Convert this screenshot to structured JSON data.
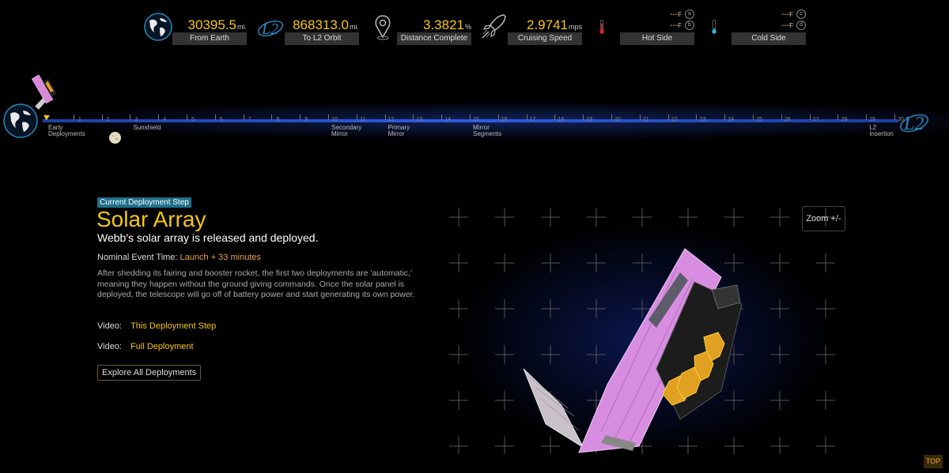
{
  "stats": [
    {
      "value": "30395.5",
      "unit": "mi.",
      "label": "From Earth",
      "icon": "earth-icon"
    },
    {
      "value": "868313.0",
      "unit": "mi.",
      "label": "To L2 Orbit",
      "icon": "l2-orbit-icon"
    },
    {
      "value": "3.3821",
      "unit": "%",
      "label": "Distance Complete",
      "icon": "map-pin-icon"
    },
    {
      "value": "2.9741",
      "unit": "mps",
      "label": "Cruising Speed",
      "icon": "rocket-icon"
    }
  ],
  "temps": [
    {
      "label": "Hot Side",
      "icon": "thermometer-hot-icon",
      "rows": [
        {
          "value": "---",
          "unit": "F",
          "key": "a"
        },
        {
          "value": "---",
          "unit": "F",
          "key": "b"
        }
      ]
    },
    {
      "label": "Cold Side",
      "icon": "thermometer-cold-icon",
      "rows": [
        {
          "value": "---",
          "unit": "F",
          "key": "c"
        },
        {
          "value": "---",
          "unit": "F",
          "key": "d"
        }
      ]
    }
  ],
  "timeline": {
    "days": [
      "0",
      "1",
      "2",
      "3",
      "4",
      "5",
      "6",
      "7",
      "8",
      "9",
      "10",
      "11",
      "12",
      "13",
      "14",
      "15",
      "16",
      "17",
      "18",
      "19",
      "20",
      "21",
      "22",
      "23",
      "24",
      "25",
      "26",
      "27",
      "28",
      "29",
      "30"
    ],
    "milestones": [
      {
        "line1": "Early",
        "line2": "Deployments",
        "day": 0
      },
      {
        "line1": "Sunshield",
        "line2": "",
        "day": 3
      },
      {
        "line1": "Secondary",
        "line2": "Mirror",
        "day": 10
      },
      {
        "line1": "Primary",
        "line2": "Mirror",
        "day": 12
      },
      {
        "line1": "Mirror",
        "line2": "Segments",
        "day": 15
      },
      {
        "line1": "L2",
        "line2": "Insertion",
        "day": 29
      }
    ],
    "end_label": "L2"
  },
  "step": {
    "tag": "Current Deployment Step",
    "title": "Solar Array",
    "subtitle": "Webb's solar array is released and deployed.",
    "event_time_label": "Nominal Event Time:",
    "event_time_value": "Launch + 33 minutes",
    "description": "After shedding its fairing and booster rocket, the first two deployments are 'automatic,' meaning they happen without the ground giving commands. Once the solar panel is deployed, the telescope will go off of battery power and start generating its own power.",
    "videos": [
      {
        "label": "Video:",
        "link": "This Deployment Step"
      },
      {
        "label": "Video:",
        "link": "Full Deployment"
      }
    ],
    "explore_label": "Explore All Deployments"
  },
  "viewer": {
    "zoom_label": "Zoom +/-"
  },
  "top_label": "TOP",
  "colors": {
    "accent": "#f5c518",
    "orange": "#e8a33c",
    "track": "#2e5be0",
    "tag": "#1f6f8b"
  }
}
